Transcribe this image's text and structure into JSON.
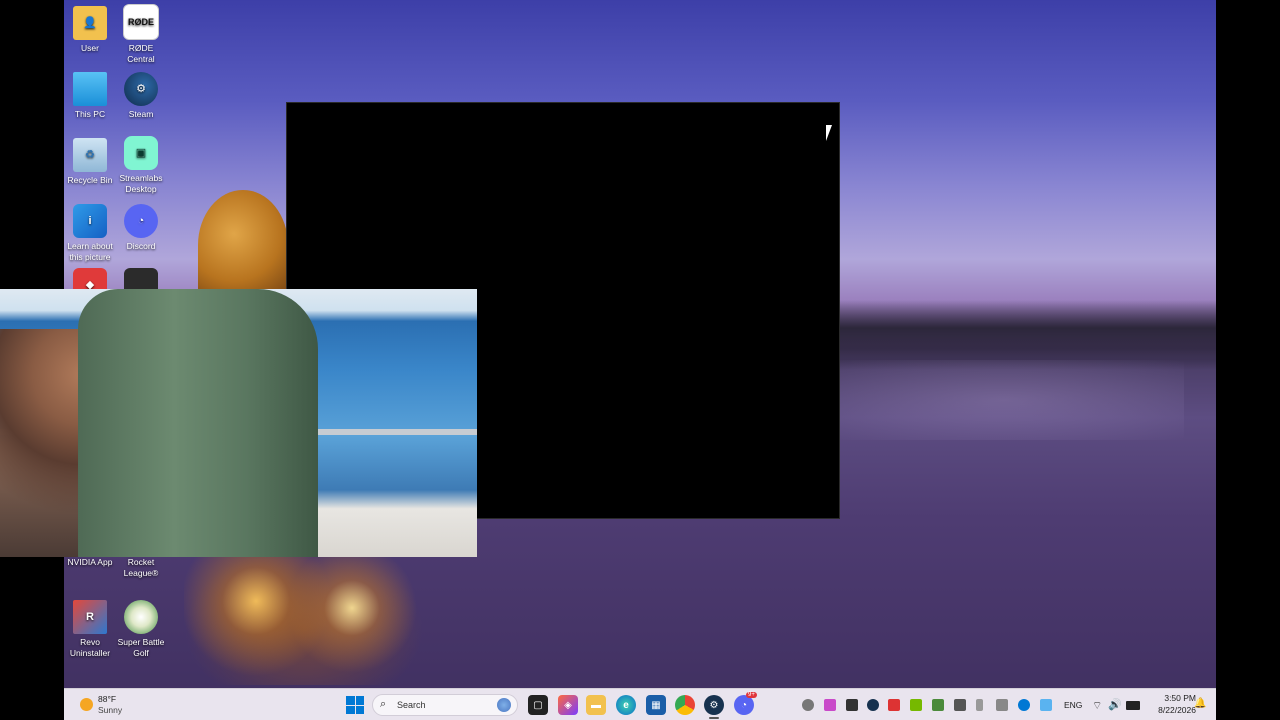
{
  "desktop": {
    "icons": [
      {
        "label": "User",
        "icon": "folder-icon"
      },
      {
        "label": "RØDE Central",
        "icon": "rode-central-icon",
        "badge": "RØDE"
      },
      {
        "label": "This PC",
        "icon": "monitor-icon"
      },
      {
        "label": "Steam",
        "icon": "steam-icon"
      },
      {
        "label": "Recycle Bin",
        "icon": "recycle-bin-icon"
      },
      {
        "label": "Streamlabs Desktop",
        "icon": "streamlabs-icon"
      },
      {
        "label": "Learn about this picture",
        "icon": "info-picture-icon"
      },
      {
        "label": "Discord",
        "icon": "discord-icon"
      },
      {
        "label": "NVIDIA App",
        "icon": "nvidia-icon"
      },
      {
        "label": "Rocket League®",
        "icon": "rocket-league-icon"
      },
      {
        "label": "Revo Uninstaller",
        "icon": "revo-uninstaller-icon"
      },
      {
        "label": "Super Battle Golf",
        "icon": "golf-icon"
      }
    ]
  },
  "taskbar": {
    "weather": {
      "temp": "88°F",
      "condition": "Sunny"
    },
    "search_placeholder": "Search",
    "language": "ENG",
    "time": "3:50 PM",
    "date": "8/22/2026",
    "discord_badge": "9+"
  },
  "colors": {
    "taskbar_bg": "#e9e4ee",
    "windows_blue": "#0078d4"
  }
}
